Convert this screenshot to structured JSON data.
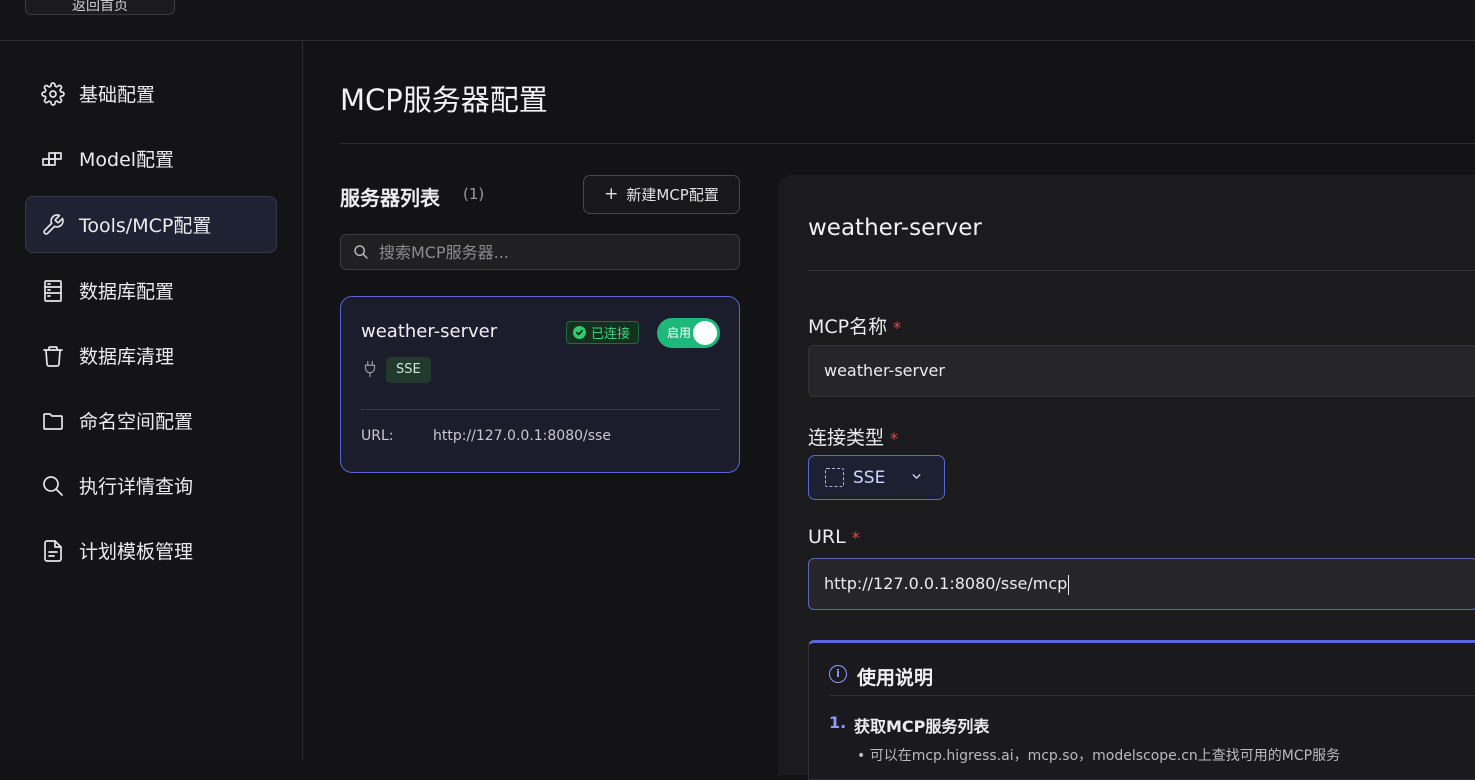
{
  "topbar": {
    "back_label": "返回首页"
  },
  "sidebar": {
    "items": [
      {
        "label": "基础配置",
        "icon": "gear-icon"
      },
      {
        "label": "Model配置",
        "icon": "model-icon"
      },
      {
        "label": "Tools/MCP配置",
        "icon": "wrench-icon",
        "active": true
      },
      {
        "label": "数据库配置",
        "icon": "database-icon"
      },
      {
        "label": "数据库清理",
        "icon": "trash-icon"
      },
      {
        "label": "命名空间配置",
        "icon": "folder-icon"
      },
      {
        "label": "执行详情查询",
        "icon": "search-icon"
      },
      {
        "label": "计划模板管理",
        "icon": "document-icon"
      }
    ]
  },
  "main": {
    "page_title": "MCP服务器配置",
    "list": {
      "title": "服务器列表",
      "count": "(1)",
      "new_button": "新建MCP配置",
      "search_placeholder": "搜索MCP服务器...",
      "servers": [
        {
          "name": "weather-server",
          "status": "已连接",
          "toggle_label": "启用",
          "type": "SSE",
          "url_label": "URL:",
          "url": "http://127.0.0.1:8080/sse"
        }
      ]
    },
    "detail": {
      "title": "weather-server",
      "name_label": "MCP名称",
      "name_value": "weather-server",
      "conn_type_label": "连接类型",
      "conn_type_value": "SSE",
      "url_label": "URL",
      "url_value": "http://127.0.0.1:8080/sse/mcp",
      "required_mark": "*",
      "help": {
        "title": "使用说明",
        "step_number": "1.",
        "step_title": "获取MCP服务列表",
        "bullet": "• 可以在mcp.higress.ai，mcp.so，modelscope.cn上查找可用的MCP服务"
      }
    }
  },
  "colors": {
    "accent": "#5a67d8",
    "active_nav_bg": "#1f2233",
    "success": "#2ecc71",
    "toggle_on": "#1db97a",
    "required": "#e5484d"
  }
}
